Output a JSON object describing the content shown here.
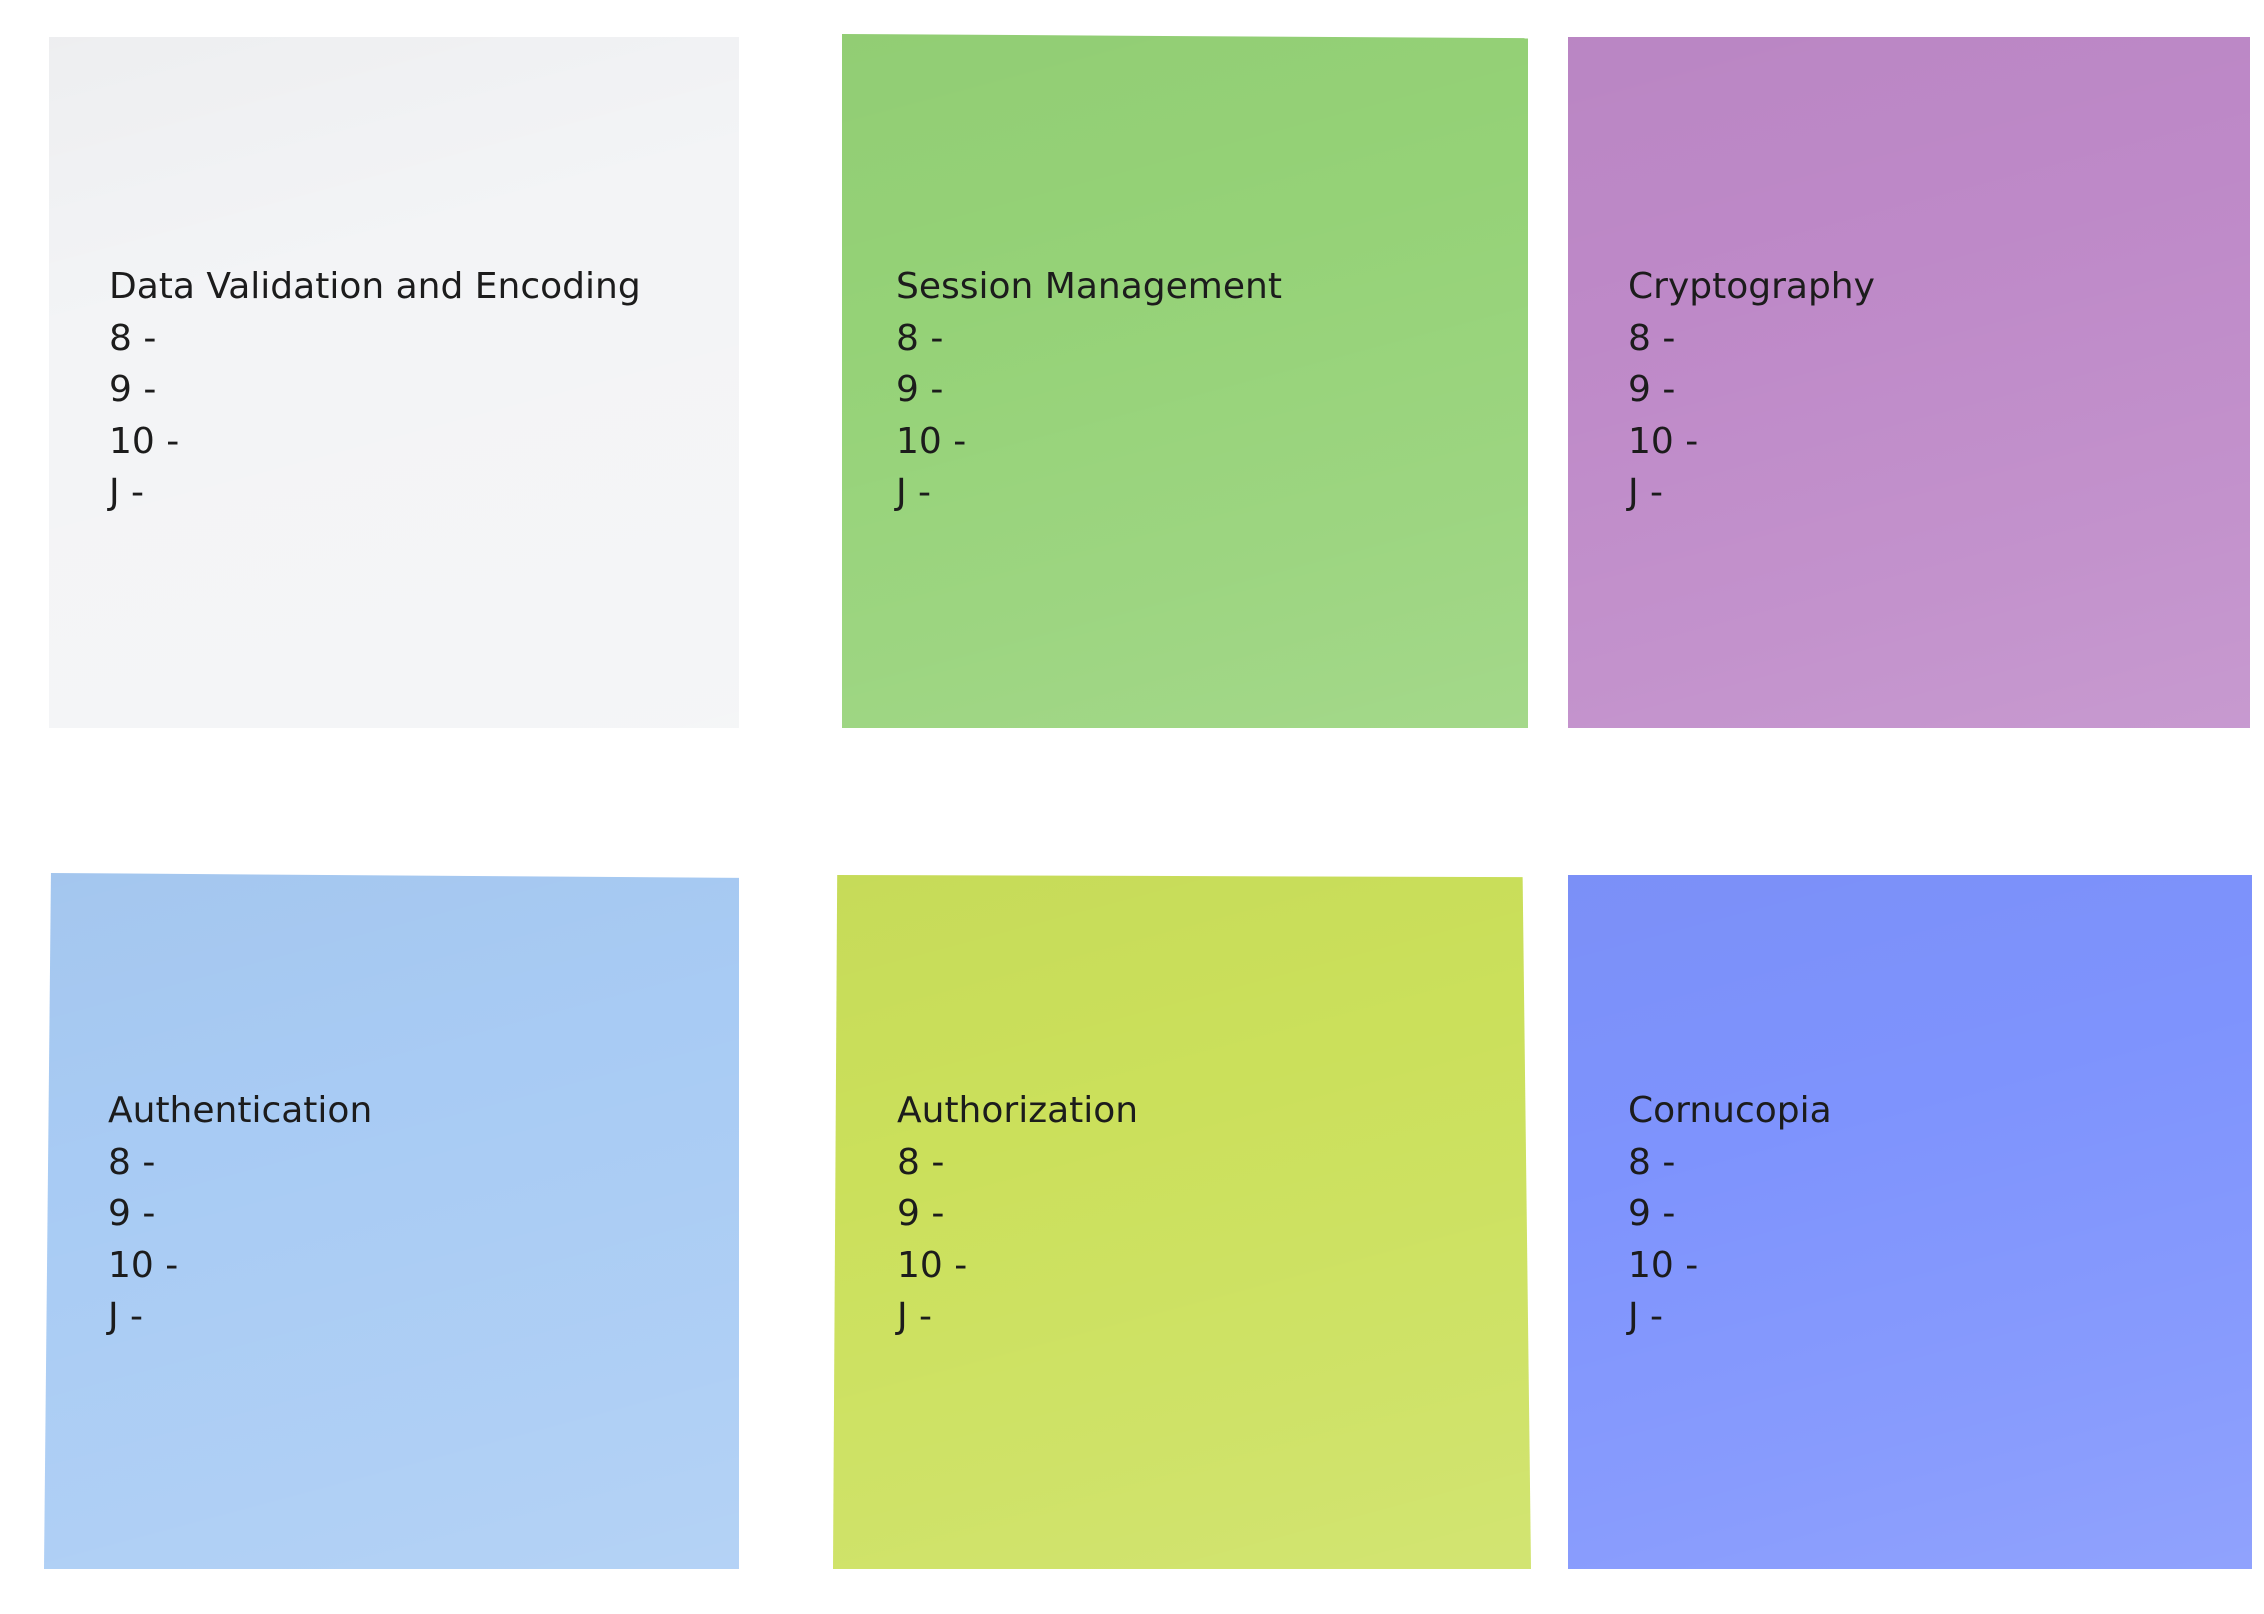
{
  "board": {
    "notes": [
      {
        "title": "Data Validation and Encoding",
        "lines": [
          "8 -",
          "9 -",
          "10 -",
          "J -"
        ],
        "color": "#f3f4f6"
      },
      {
        "title": "Session Management",
        "lines": [
          "8 -",
          "9 -",
          "10 -",
          "J -"
        ],
        "color": "#95d277"
      },
      {
        "title": "Cryptography",
        "lines": [
          "8 -",
          "9 -",
          "10 -",
          "J -"
        ],
        "color": "#be89c8"
      },
      {
        "title": "Authentication",
        "lines": [
          "8 -",
          "9 -",
          "10 -",
          "J -"
        ],
        "color": "#a8cbf4"
      },
      {
        "title": "Authorization",
        "lines": [
          "8 -",
          "9 -",
          "10 -",
          "J -"
        ],
        "color": "#cbe05b"
      },
      {
        "title": "Cornucopia",
        "lines": [
          "8 -",
          "9 -",
          "10 -",
          "J -"
        ],
        "color": "#7e93fd"
      }
    ]
  }
}
